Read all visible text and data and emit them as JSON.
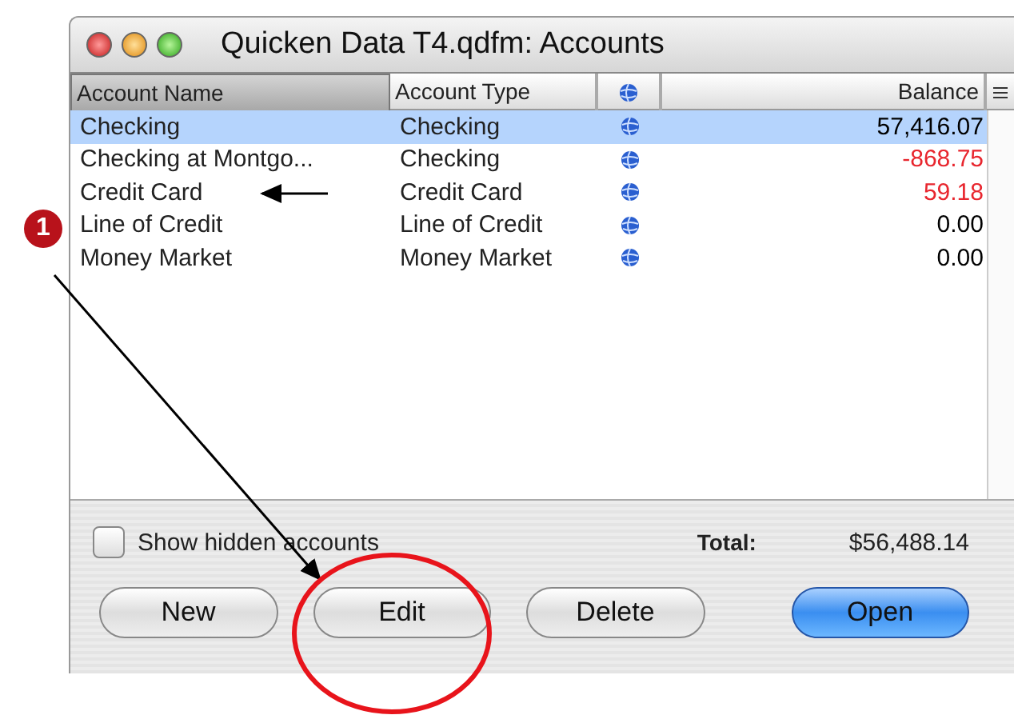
{
  "window": {
    "title": "Quicken Data T4.qdfm: Accounts"
  },
  "table": {
    "columns": [
      {
        "label": "Account Name",
        "kind": "text",
        "sorted": true
      },
      {
        "label": "Account Type",
        "kind": "text",
        "sorted": false
      },
      {
        "kind": "globe",
        "sorted": false
      },
      {
        "label": "Balance",
        "kind": "amount",
        "sorted": false
      }
    ],
    "rows": [
      {
        "name": "Checking",
        "type": "Checking",
        "balance": "57,416.07",
        "color": "#000000",
        "selected": true
      },
      {
        "name": "Checking at Montgo...",
        "type": "Checking",
        "balance": "-868.75",
        "color": "#e8262e",
        "selected": false
      },
      {
        "name": "Credit Card",
        "type": "Credit Card",
        "balance": "59.18",
        "color": "#e8262e",
        "selected": false
      },
      {
        "name": "Line of Credit",
        "type": "Line of Credit",
        "balance": "0.00",
        "color": "#000000",
        "selected": false
      },
      {
        "name": "Money Market",
        "type": "Money Market",
        "balance": "0.00",
        "color": "#000000",
        "selected": false
      }
    ]
  },
  "footer": {
    "show_hidden": {
      "label": "Show hidden accounts",
      "checked": false
    },
    "total_label": "Total:",
    "total": "$56,488.14"
  },
  "buttons": [
    {
      "label": "New",
      "kind": "normal"
    },
    {
      "label": "Edit",
      "kind": "normal"
    },
    {
      "label": "Delete",
      "kind": "normal"
    },
    {
      "label": "Open",
      "kind": "default"
    }
  ],
  "annotations": {
    "badge": "1"
  }
}
